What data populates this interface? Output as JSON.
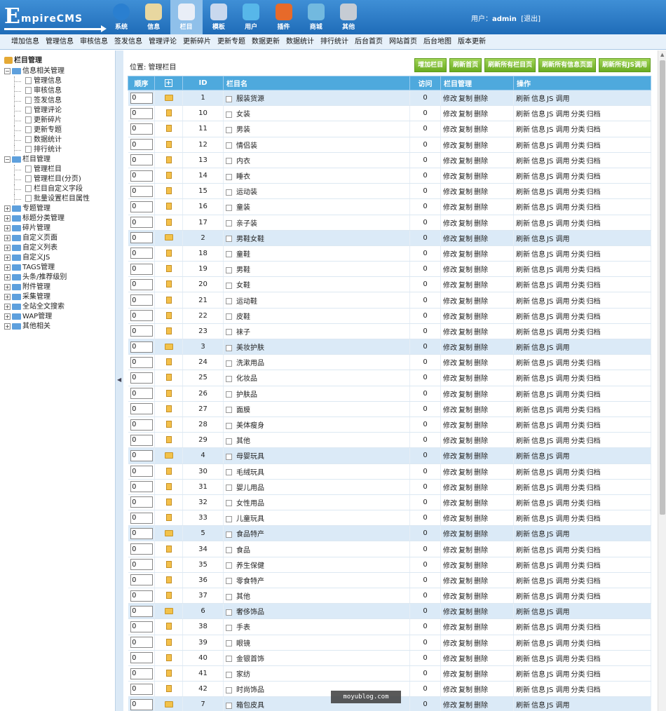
{
  "brand": {
    "letter": "E",
    "rest": "mpireCMS"
  },
  "topnav": [
    {
      "label": "系统",
      "icon": "globe-icon",
      "color": "#2a7fd0"
    },
    {
      "label": "信息",
      "icon": "notepad-icon",
      "color": "#e8d7a0"
    },
    {
      "label": "栏目",
      "icon": "folder-icon",
      "color": "#e9eef7"
    },
    {
      "label": "模板",
      "icon": "window-icon",
      "color": "#c8d8ee"
    },
    {
      "label": "用户",
      "icon": "user-icon",
      "color": "#57b7e9"
    },
    {
      "label": "插件",
      "icon": "tools-icon",
      "color": "#e76a2a"
    },
    {
      "label": "商城",
      "icon": "card-icon",
      "color": "#72b9df"
    },
    {
      "label": "其他",
      "icon": "gear-icon",
      "color": "#c6ccd4"
    }
  ],
  "user": {
    "prefix": "用户：",
    "name": "admin",
    "logout": "[退出]"
  },
  "subnav": [
    "增加信息",
    "管理信息",
    "审核信息",
    "签发信息",
    "管理评论",
    "更新碎片",
    "更新专题",
    "数据更新",
    "数据统计",
    "排行统计",
    "后台首页",
    "网站首页",
    "后台地图",
    "版本更新"
  ],
  "sidebar": {
    "root": "栏目管理",
    "g1": {
      "label": "信息相关管理",
      "items": [
        "管理信息",
        "审核信息",
        "签发信息",
        "管理评论",
        "更新碎片",
        "更新专题",
        "数据统计",
        "排行统计"
      ]
    },
    "g2": {
      "label": "栏目管理",
      "items": [
        "管理栏目",
        "管理栏目(分页)",
        "栏目自定义字段",
        "批量设置栏目属性"
      ]
    },
    "groups": [
      "专题管理",
      "标题分类管理",
      "碎片管理",
      "自定义页面",
      "自定义列表",
      "自定义JS",
      "TAGS管理",
      "头条/推荐级别",
      "附件管理",
      "采集管理",
      "全站全文搜索",
      "WAP管理",
      "其他相关"
    ]
  },
  "crumb": "位置: 管理栏目",
  "buttons": [
    "增加栏目",
    "刷新首页",
    "刷新所有栏目页",
    "刷新所有信息页面",
    "刷新所有JS调用"
  ],
  "table": {
    "headers": [
      "顺序",
      "ID",
      "栏目名",
      "访问",
      "栏目管理",
      "操作"
    ],
    "ordinal": "0",
    "visits": "0",
    "manage": [
      "修改",
      "复制",
      "删除"
    ],
    "ops_parent": [
      "刷新",
      "信息",
      "JS 调用"
    ],
    "ops_child": [
      "刷新",
      "信息",
      "JS 调用",
      "分类",
      "归档"
    ],
    "rows": [
      {
        "id": "1",
        "name": "服装货源",
        "parent": true
      },
      {
        "id": "10",
        "name": "女装",
        "parent": false
      },
      {
        "id": "11",
        "name": "男装",
        "parent": false
      },
      {
        "id": "12",
        "name": "情侣装",
        "parent": false
      },
      {
        "id": "13",
        "name": "内衣",
        "parent": false
      },
      {
        "id": "14",
        "name": "睡衣",
        "parent": false
      },
      {
        "id": "15",
        "name": "运动装",
        "parent": false
      },
      {
        "id": "16",
        "name": "童装",
        "parent": false
      },
      {
        "id": "17",
        "name": "亲子装",
        "parent": false
      },
      {
        "id": "2",
        "name": "男鞋女鞋",
        "parent": true
      },
      {
        "id": "18",
        "name": "童鞋",
        "parent": false
      },
      {
        "id": "19",
        "name": "男鞋",
        "parent": false
      },
      {
        "id": "20",
        "name": "女鞋",
        "parent": false
      },
      {
        "id": "21",
        "name": "运动鞋",
        "parent": false
      },
      {
        "id": "22",
        "name": "皮鞋",
        "parent": false
      },
      {
        "id": "23",
        "name": "袜子",
        "parent": false
      },
      {
        "id": "3",
        "name": "美妆护肤",
        "parent": true
      },
      {
        "id": "24",
        "name": "洗漱用品",
        "parent": false
      },
      {
        "id": "25",
        "name": "化妆品",
        "parent": false
      },
      {
        "id": "26",
        "name": "护肤品",
        "parent": false
      },
      {
        "id": "27",
        "name": "面膜",
        "parent": false
      },
      {
        "id": "28",
        "name": "美体瘦身",
        "parent": false
      },
      {
        "id": "29",
        "name": "其他",
        "parent": false
      },
      {
        "id": "4",
        "name": "母婴玩具",
        "parent": true
      },
      {
        "id": "30",
        "name": "毛绒玩具",
        "parent": false
      },
      {
        "id": "31",
        "name": "婴儿用品",
        "parent": false
      },
      {
        "id": "32",
        "name": "女性用品",
        "parent": false
      },
      {
        "id": "33",
        "name": "儿童玩具",
        "parent": false
      },
      {
        "id": "5",
        "name": "食品特产",
        "parent": true
      },
      {
        "id": "34",
        "name": "食品",
        "parent": false
      },
      {
        "id": "35",
        "name": "养生保健",
        "parent": false
      },
      {
        "id": "36",
        "name": "零食特产",
        "parent": false
      },
      {
        "id": "37",
        "name": "其他",
        "parent": false
      },
      {
        "id": "6",
        "name": "奢侈饰品",
        "parent": true
      },
      {
        "id": "38",
        "name": "手表",
        "parent": false
      },
      {
        "id": "39",
        "name": "眼镜",
        "parent": false
      },
      {
        "id": "40",
        "name": "金银首饰",
        "parent": false
      },
      {
        "id": "41",
        "name": "家纺",
        "parent": false
      },
      {
        "id": "42",
        "name": "时尚饰品",
        "parent": false
      },
      {
        "id": "7",
        "name": "箱包皮具",
        "parent": true
      }
    ]
  },
  "watermark": "moyublog.com"
}
